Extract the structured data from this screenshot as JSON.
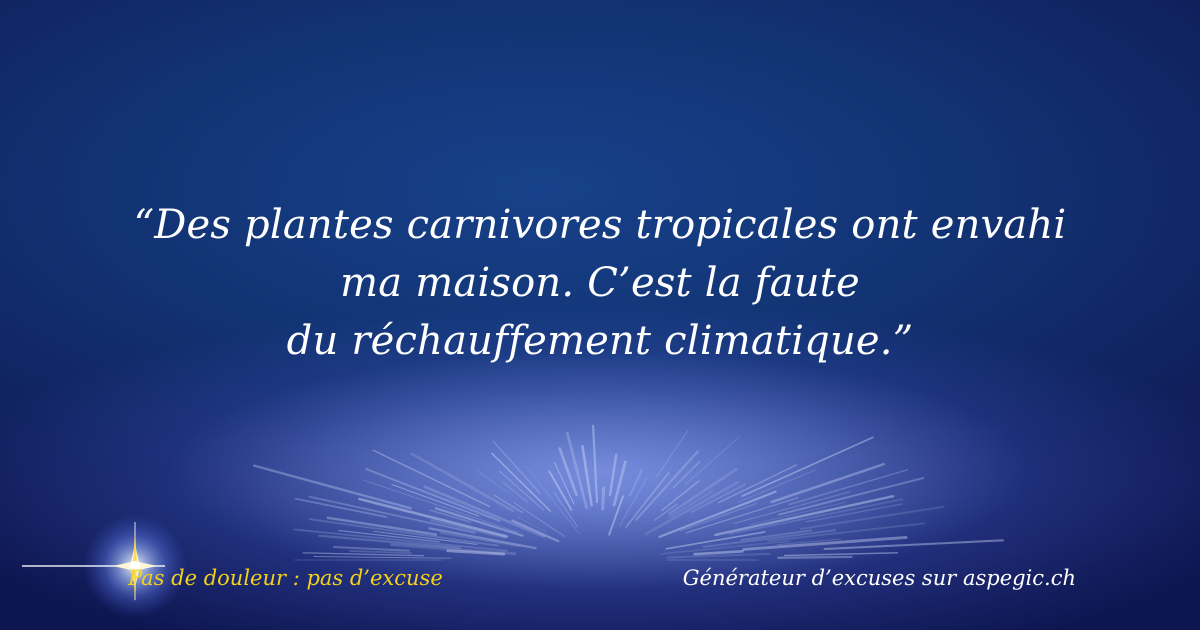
{
  "quote": {
    "line1": "“Des plantes carnivores tropicales ont envahi",
    "line2": "ma maison. C’est la faute",
    "line3": "du réchauffement climatique.”"
  },
  "footer": {
    "slogan": "Pas de douleur : pas d’excuse",
    "credit": "Générateur d’excuses sur aspegic.ch"
  },
  "colors": {
    "slogan": "#f2d21b",
    "text": "#ffffff",
    "background_top": "#123373",
    "glow": "#6f86f0"
  },
  "icons": {
    "logo": "sparkle-star-icon"
  }
}
